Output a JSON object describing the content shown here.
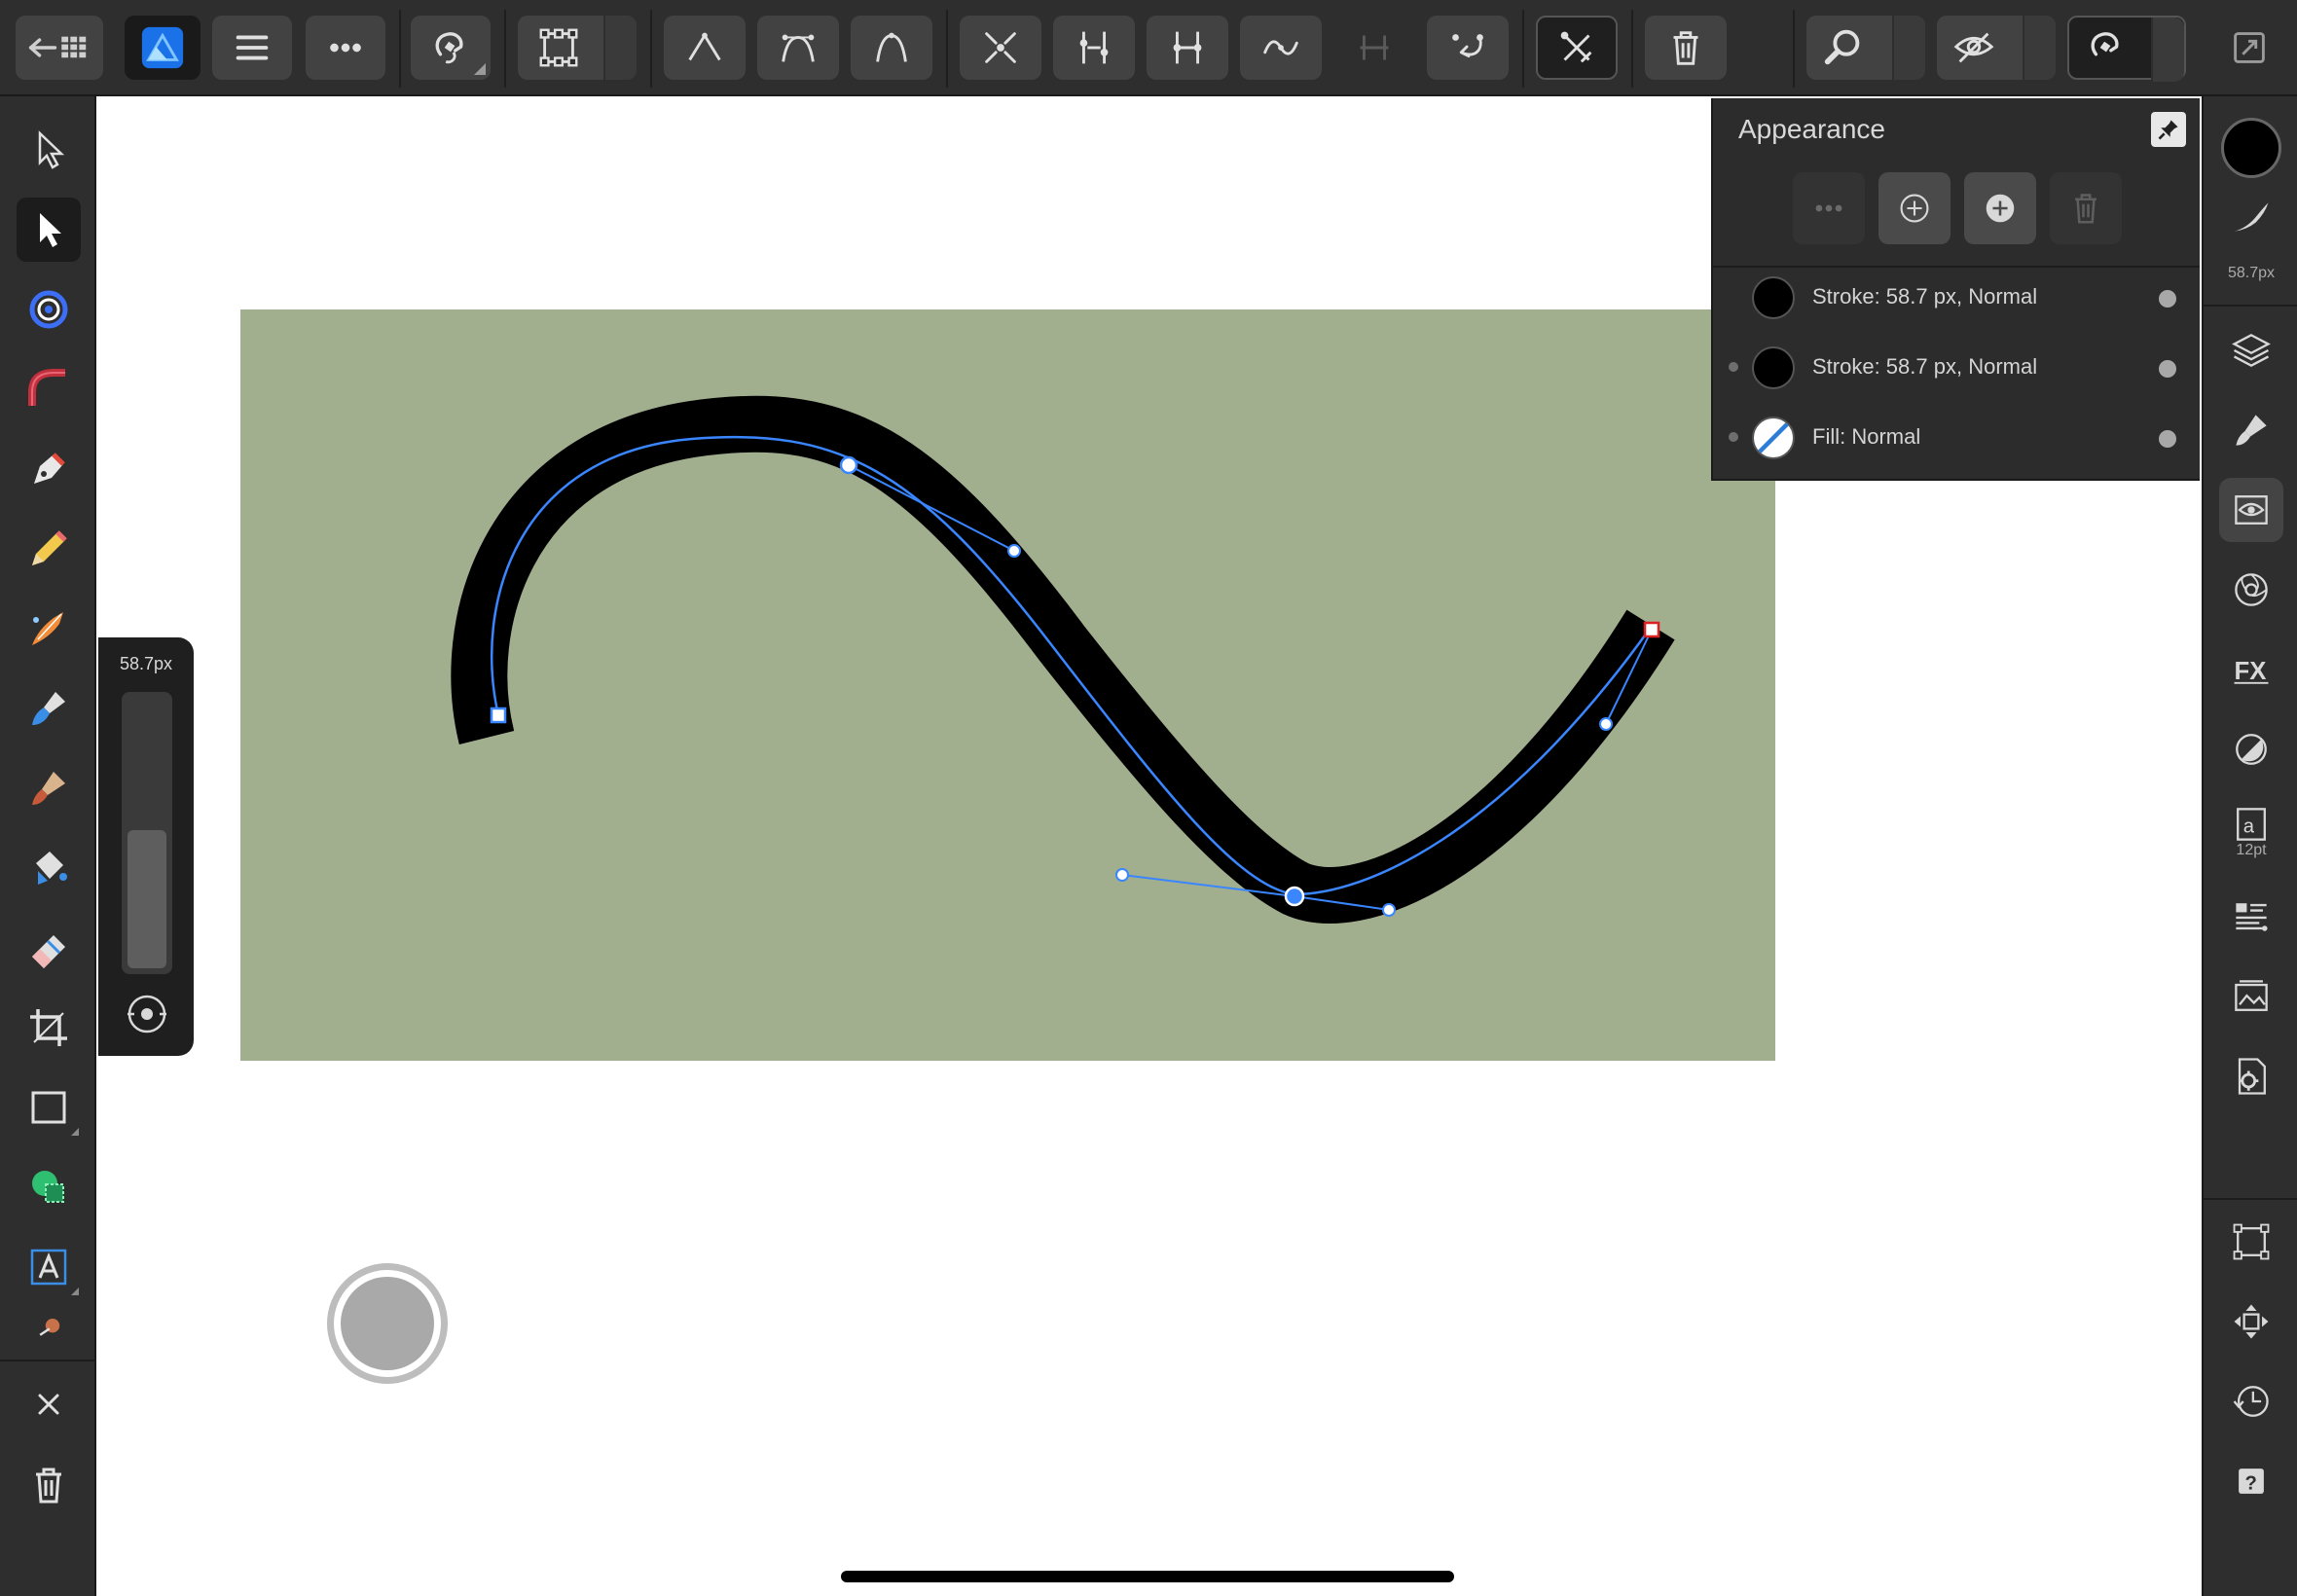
{
  "app": {
    "name": "Affinity Designer"
  },
  "colors": {
    "toolbar_bg": "#2e2e2e",
    "artboard_fill": "#a1af8f",
    "stroke": "#000000",
    "path_line": "#3a86ff",
    "end_node_selected": "#e02020"
  },
  "appearance_panel": {
    "title": "Appearance",
    "rows": [
      {
        "label": "Stroke: 58.7 px, Normal",
        "swatch": "black-circle"
      },
      {
        "label": "Stroke: 58.7 px, Normal",
        "swatch": "black-circle"
      },
      {
        "label": "Fill: Normal",
        "swatch": "no-fill"
      }
    ]
  },
  "width_popup": {
    "value": "58.7px",
    "fill_fraction": 0.5
  },
  "right_bar": {
    "stroke_width": "58.7px",
    "text_size": "12pt"
  }
}
